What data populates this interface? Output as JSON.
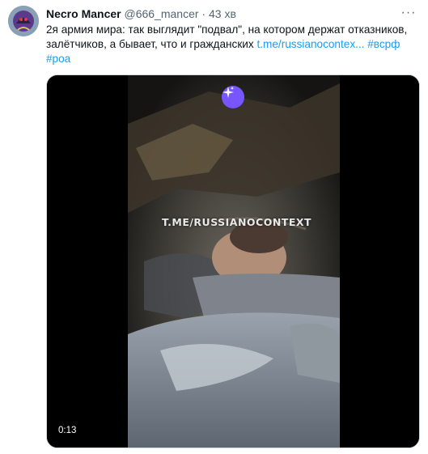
{
  "tweet": {
    "author_name": "Necro Mancer",
    "handle": "@666_mancer",
    "separator": "·",
    "time": "43 хв",
    "text_line1": "2я армия мира: так выглядит \"подвал\", на котором держат отказников,",
    "text_line2_prefix": "залётчиков, а бывает, что и гражданских ",
    "link_text": "t.me/russianocontex...",
    "hashtag1": "#всрф",
    "hashtag2": "#роа",
    "menu_glyph": "···"
  },
  "media": {
    "watermark": "T.ME/RUSSIANOCONTEXT",
    "duration": "0:13",
    "sparkle_icon": "sparkle-icon"
  },
  "colors": {
    "link": "#1d9bf0",
    "sparkle_bg": "#7856ff",
    "secondary_text": "#536471"
  }
}
